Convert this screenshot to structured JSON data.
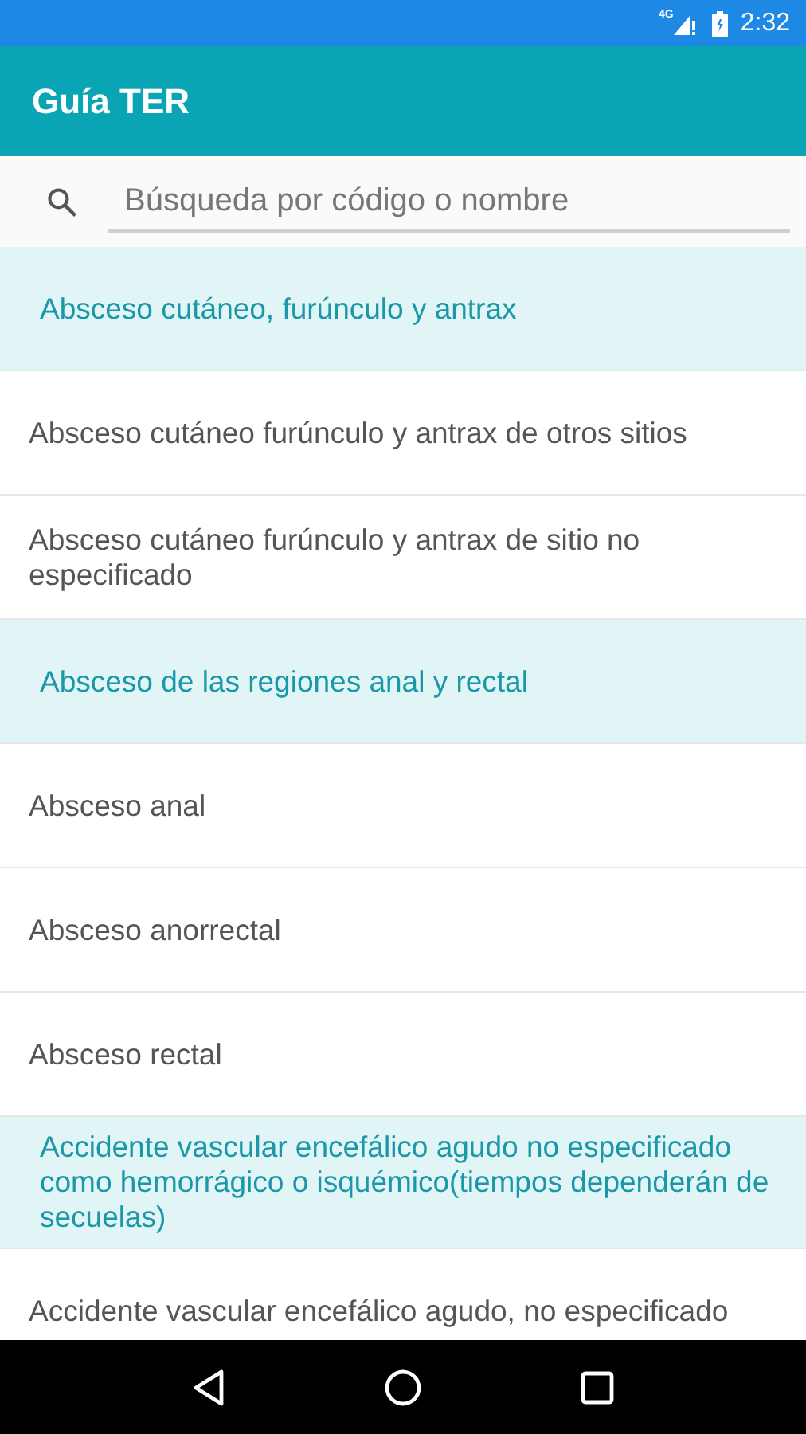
{
  "status_bar": {
    "network": "4G",
    "time": "2:32"
  },
  "app_bar": {
    "title": "Guía TER"
  },
  "search": {
    "placeholder": "Búsqueda por código o nombre"
  },
  "list": [
    {
      "kind": "header",
      "text": "Absceso cutáneo, furúnculo y antrax"
    },
    {
      "kind": "item",
      "text": "Absceso cutáneo furúnculo y antrax de otros sitios"
    },
    {
      "kind": "item",
      "text": "Absceso cutáneo furúnculo y antrax de sitio no especificado"
    },
    {
      "kind": "header",
      "text": "Absceso de las regiones anal y rectal"
    },
    {
      "kind": "item",
      "text": "Absceso anal"
    },
    {
      "kind": "item",
      "text": "Absceso anorrectal"
    },
    {
      "kind": "item",
      "text": "Absceso rectal"
    },
    {
      "kind": "header",
      "text": "Accidente vascular encefálico agudo no especificado como hemorrágico o isquémico(tiempos dependerán de secuelas)"
    },
    {
      "kind": "item",
      "text": "Accidente vascular encefálico agudo, no especificado"
    }
  ]
}
